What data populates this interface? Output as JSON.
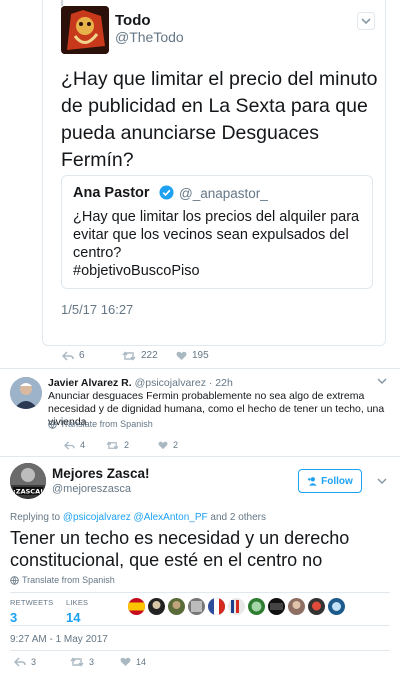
{
  "tweet1": {
    "name": "Todo",
    "handle": "@TheTodo",
    "text": "¿Hay que limitar el precio del minuto de publicidad en La Sexta para que pueda anunciarse Desguaces Fermín?",
    "quoted": {
      "name": "Ana Pastor",
      "handle": "@_anapastor_",
      "text_lines": [
        "¿Hay que limitar los precios del alquiler para",
        "evitar que los vecinos sean expulsados del",
        "centro?",
        "#objetivoBuscoPiso"
      ]
    },
    "timestamp": "1/5/17 16:27",
    "actions": {
      "reply_count": "6",
      "retweet_count": "222",
      "like_count": "195"
    }
  },
  "tweet2": {
    "name": "Javier Alvarez R.",
    "handle": "@psicojalvarez",
    "time": "· 22h",
    "text": "Anunciar desguaces Fermin probablemente no sea algo de extrema necesidad y de dignidad humana, como el hecho de tener un techo, una vivienda",
    "translate": "Translate from Spanish",
    "actions": {
      "reply_count": "4",
      "retweet_count": "2",
      "like_count": "2"
    }
  },
  "tweet3": {
    "name": "Mejores Zasca!",
    "handle": "@mejoreszasca",
    "follow_label": "Follow",
    "reply_prefix": "Replying to ",
    "reply_users": "@psicojalvarez @AlexAnton_PF",
    "reply_suffix": " and 2 others",
    "text": "Tener un techo es necesidad y un derecho constitucional, que esté en el centro no",
    "translate": "Translate from Spanish",
    "retweets_label": "RETWEETS",
    "retweets_count": "3",
    "likes_label": "LIKES",
    "likes_count": "14",
    "timestamp": "9:27 AM - 1 May 2017",
    "actions": {
      "reply_count": "3",
      "retweet_count": "3",
      "like_count": "14"
    }
  },
  "colors": {
    "accent": "#1da1f2",
    "muted": "#657786",
    "border": "#e1e8ed"
  }
}
